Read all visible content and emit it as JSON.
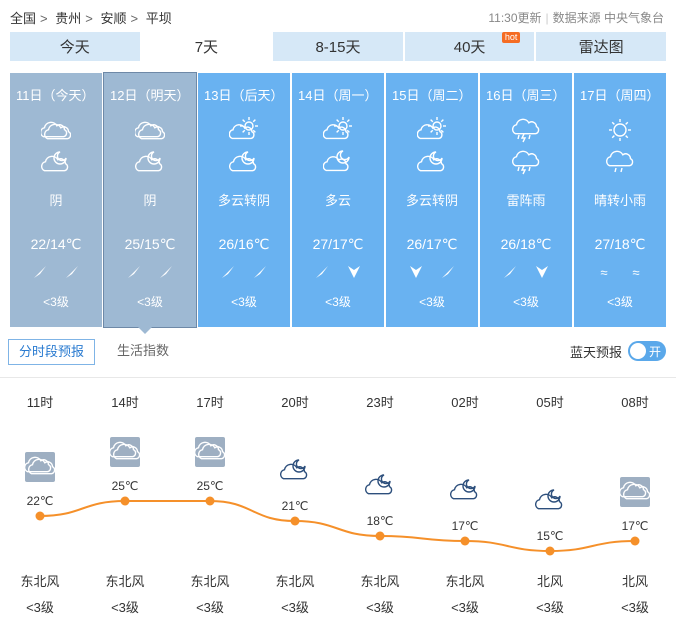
{
  "breadcrumb": [
    "全国",
    "贵州",
    "安顺",
    "平坝"
  ],
  "breadcrumb_sep": ">",
  "update_time": "11:30更新",
  "source": "数据来源 中央气象台",
  "tabs": [
    {
      "label": "今天"
    },
    {
      "label": "7天",
      "active": true
    },
    {
      "label": "8-15天"
    },
    {
      "label": "40天",
      "badge": "hot"
    },
    {
      "label": "雷达图"
    }
  ],
  "days": [
    {
      "date": "11日（今天）",
      "icon_day": "overcast-cloud-icon",
      "icon_night": "cloudy-night-icon",
      "desc": "阴",
      "temp": "22/14℃",
      "wind1": "northeast-arrow",
      "wind2": "northeast-arrow",
      "level": "<3级",
      "state": "past"
    },
    {
      "date": "12日（明天）",
      "icon_day": "overcast-cloud-icon",
      "icon_night": "cloudy-night-icon",
      "desc": "阴",
      "temp": "25/15℃",
      "wind1": "northeast-arrow",
      "wind2": "northeast-arrow",
      "level": "<3级",
      "state": "selected"
    },
    {
      "date": "13日（后天）",
      "icon_day": "partly-cloudy-day-icon",
      "icon_night": "cloudy-night-icon",
      "desc": "多云转阴",
      "temp": "26/16℃",
      "wind1": "northeast-arrow",
      "wind2": "northeast-arrow",
      "level": "<3级"
    },
    {
      "date": "14日（周一）",
      "icon_day": "partly-cloudy-day-icon",
      "icon_night": "partly-cloudy-night-icon",
      "desc": "多云",
      "temp": "27/17℃",
      "wind1": "northeast-arrow",
      "wind2": "north-arrow",
      "level": "<3级"
    },
    {
      "date": "15日（周二）",
      "icon_day": "partly-cloudy-day-icon",
      "icon_night": "cloudy-night-icon",
      "desc": "多云转阴",
      "temp": "26/17℃",
      "wind1": "north-arrow",
      "wind2": "northeast-arrow",
      "level": "<3级"
    },
    {
      "date": "16日（周三）",
      "icon_day": "thunderstorm-icon",
      "icon_night": "thunderstorm-icon",
      "desc": "雷阵雨",
      "temp": "26/18℃",
      "wind1": "northeast-arrow",
      "wind2": "north-arrow",
      "level": "<3级"
    },
    {
      "date": "17日（周四）",
      "icon_day": "sun-icon",
      "icon_night": "light-rain-icon",
      "desc": "晴转小雨",
      "temp": "27/18℃",
      "wind1": "≈",
      "wind2": "≈",
      "level": "<3级"
    }
  ],
  "subtabs": [
    {
      "label": "分时段预报",
      "active": true
    },
    {
      "label": "生活指数"
    }
  ],
  "bluesky": {
    "label": "蓝天预报",
    "toggle": "开"
  },
  "hourly": [
    {
      "hour": "11时",
      "temp": 22,
      "temp_label": "22℃",
      "icon": "overcast-cloud-icon",
      "wind": "东北风",
      "level": "<3级"
    },
    {
      "hour": "14时",
      "temp": 25,
      "temp_label": "25℃",
      "icon": "overcast-cloud-icon",
      "wind": "东北风",
      "level": "<3级"
    },
    {
      "hour": "17时",
      "temp": 25,
      "temp_label": "25℃",
      "icon": "overcast-cloud-icon",
      "wind": "东北风",
      "level": "<3级"
    },
    {
      "hour": "20时",
      "temp": 21,
      "temp_label": "21℃",
      "icon": "cloudy-night-icon",
      "wind": "东北风",
      "level": "<3级"
    },
    {
      "hour": "23时",
      "temp": 18,
      "temp_label": "18℃",
      "icon": "cloudy-night-icon",
      "wind": "东北风",
      "level": "<3级"
    },
    {
      "hour": "02时",
      "temp": 17,
      "temp_label": "17℃",
      "icon": "cloudy-night-icon",
      "wind": "东北风",
      "level": "<3级"
    },
    {
      "hour": "05时",
      "temp": 15,
      "temp_label": "15℃",
      "icon": "cloudy-night-icon",
      "wind": "北风",
      "level": "<3级"
    },
    {
      "hour": "08时",
      "temp": 17,
      "temp_label": "17℃",
      "icon": "overcast-cloud-icon",
      "wind": "北风",
      "level": "<3级"
    }
  ],
  "colors": {
    "accent": "#f5902a",
    "card": "#69b2f1",
    "card_past": "#9eb9d3",
    "tab_bg": "#d6e8f7"
  }
}
